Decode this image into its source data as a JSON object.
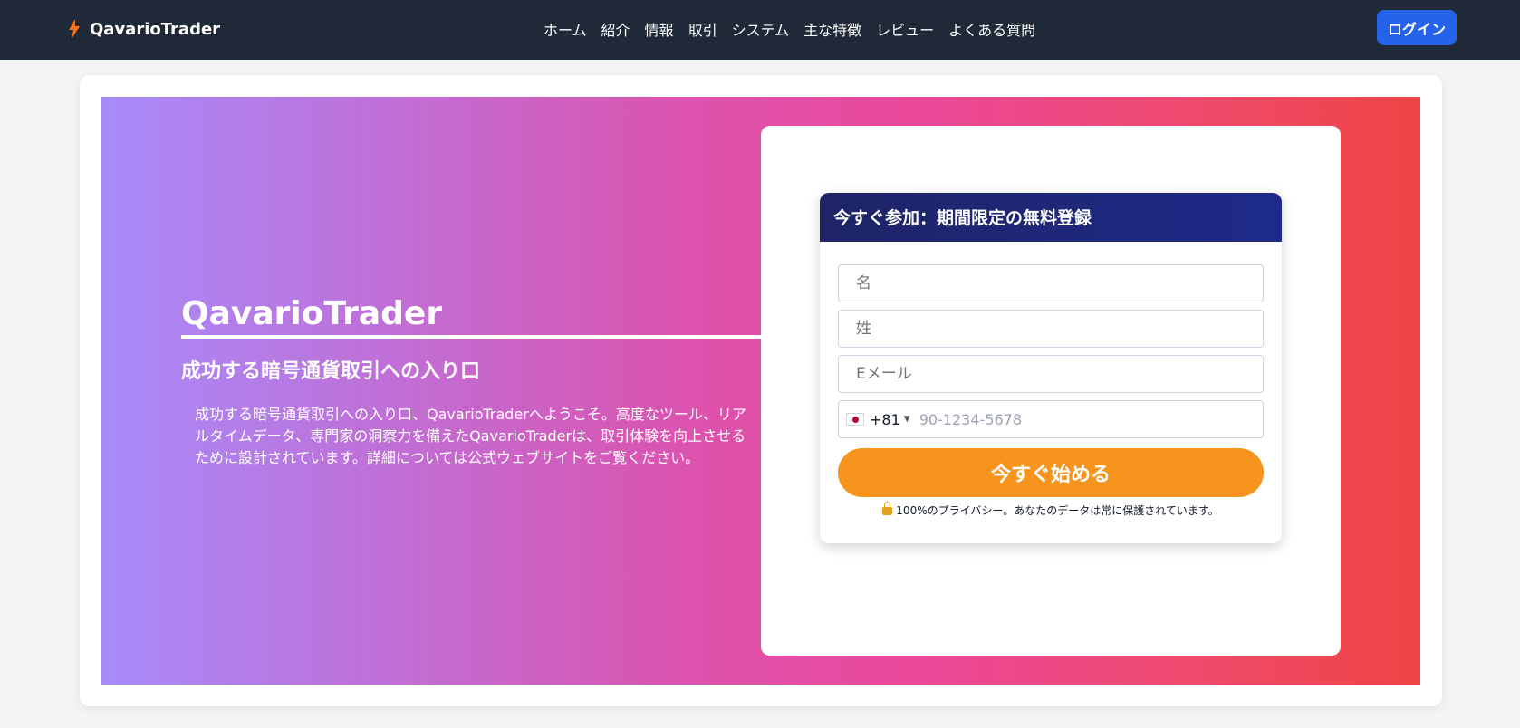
{
  "header": {
    "brand": "QavarioTrader",
    "nav": [
      "ホーム",
      "紹介",
      "情報",
      "取引",
      "システム",
      "主な特徴",
      "レビュー",
      "よくある質問"
    ],
    "login_label": "ログイン"
  },
  "hero": {
    "title": "QavarioTrader",
    "subtitle": "成功する暗号通貨取引への入り口",
    "description": "成功する暗号通貨取引への入り口、QavarioTraderへようこそ。高度なツール、リアルタイムデータ、専門家の洞察力を備えたQavarioTraderは、取引体験を向上させるために設計されています。詳細については公式ウェブサイトをご覧ください。"
  },
  "form": {
    "heading": "今すぐ参加：期間限定の無料登録",
    "first_name_placeholder": "名",
    "last_name_placeholder": "姓",
    "email_placeholder": "Eメール",
    "country_code": "+81",
    "phone_placeholder": "90-1234-5678",
    "submit_label": "今すぐ始める",
    "privacy_text": "100%のプライバシー。あなたのデータは常に保護されています。"
  },
  "colors": {
    "header_bg": "#1f2937",
    "login_bg": "#2563eb",
    "button_orange": "#f7941d",
    "form_header_bg": "#1e2466",
    "brand_icon": "#f97316"
  },
  "icons": {
    "brand": "lightning-bolt-icon",
    "flag": "japan-flag-icon",
    "lock": "lock-icon"
  }
}
